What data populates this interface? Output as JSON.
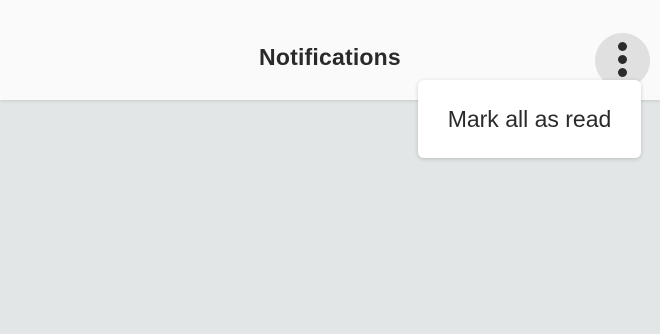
{
  "header": {
    "title": "Notifications",
    "more_icon": "vertical-ellipsis-icon"
  },
  "menu": {
    "items": [
      {
        "label": "Mark all as read"
      }
    ]
  },
  "colors": {
    "header_bg": "#fafafa",
    "page_bg": "#e3e6e6",
    "text": "#2a2a2a",
    "button_bg": "#e0e0e0"
  }
}
